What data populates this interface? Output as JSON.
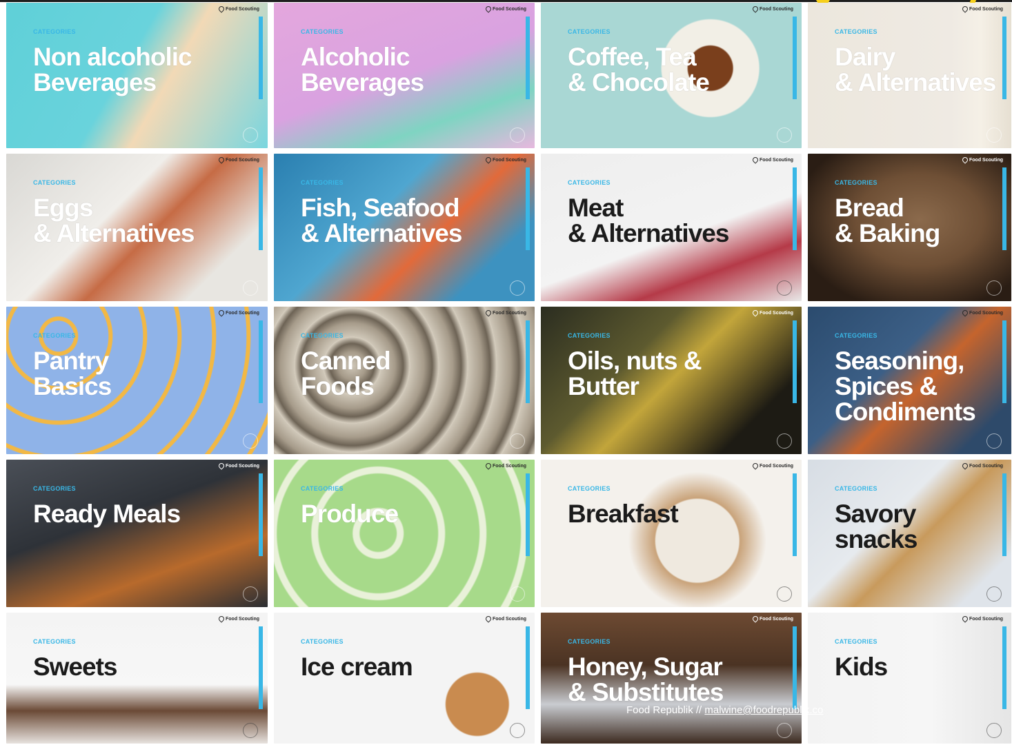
{
  "brand": "Food Scouting",
  "badge_text": "Food Republik",
  "tiles": [
    {
      "category": "CATEGORIES",
      "title": "Non alcoholic\nBeverages",
      "theme": "light",
      "bg": "linear-gradient(120deg,#5fd0d8 0%,#69d3dc 45%,#f2d9b6 60%,#79d6df 100%)"
    },
    {
      "category": "CATEGORIES",
      "title": "Alcoholic\nBeverages",
      "theme": "light",
      "bg": "linear-gradient(160deg,#e4a7dd 0%,#d9a2e0 50%,#7fd4c2 75%,#e7b8de 100%)"
    },
    {
      "category": "CATEGORIES",
      "title": "Coffee, Tea\n& Chocolate",
      "theme": "light",
      "bg": "radial-gradient(circle at 65% 45%,#7a3f1c 0,#7a3f1c 32px,#f2efe6 34px,#f2efe6 70px,#a9d7d4 72px)"
    },
    {
      "category": "CATEGORIES",
      "title": "Dairy\n& Alternatives",
      "theme": "light",
      "bg": "linear-gradient(90deg,#ece7dd 0%,#efeae3 70%,#f5f0e6 85%,#e6dfd2 100%)"
    },
    {
      "category": "CATEGORIES",
      "title": "Eggs\n& Alternatives",
      "theme": "light",
      "bg": "linear-gradient(135deg,#d9d8d4 0%,#f0eeea 40%,#c66b45 55%,#e8e6e1 80%)"
    },
    {
      "category": "CATEGORIES",
      "title": "Fish, Seafood\n& Alternatives",
      "theme": "light",
      "bg": "linear-gradient(135deg,#2a7fb0 0%,#4fa6d0 40%,#e26a3a 60%,#3d92c0 80%)"
    },
    {
      "category": "CATEGORIES",
      "title": "Meat\n& Alternatives",
      "theme": "dark",
      "bg": "linear-gradient(160deg,#eeeeee 0%,#f3f3f3 55%,#b53a48 75%,#e8e8e8 100%)"
    },
    {
      "category": "CATEGORIES",
      "title": "Bread\n& Baking",
      "theme": "light",
      "bg": "radial-gradient(ellipse at 55% 45%,#8b6a4c 0,#6e4f35 40%,#2a1d14 80%)"
    },
    {
      "category": "CATEGORIES",
      "title": "Pantry\nBasics",
      "theme": "light",
      "bg": "repeating-radial-gradient(circle at 20% 20%,#8fb3e8 0,#8fb3e8 22px,#f2b845 23px,#f2b845 28px,#8fb3e8 29px,#8fb3e8 50px)"
    },
    {
      "category": "CATEGORIES",
      "title": "Canned\nFoods",
      "theme": "light",
      "bg": "repeating-radial-gradient(circle at 30% 40%,#cfc7b8 0,#a69b8a 20px,#6d6355 32px,#d9d1c2 42px)"
    },
    {
      "category": "CATEGORIES",
      "title": "Oils, nuts &\nButter",
      "theme": "light",
      "bg": "linear-gradient(135deg,#2b2d20 0%,#5d5a2f 35%,#c2a53b 50%,#1d1b14 80%)"
    },
    {
      "category": "CATEGORIES",
      "title": "Seasoning,\nSpices &\nCondiments",
      "theme": "light",
      "bg": "linear-gradient(135deg,#2b4b6e 0%,#3c5f86 40%,#c5642d 55%,#2e4a6a 85%)"
    },
    {
      "category": "CATEGORIES",
      "title": "Ready Meals",
      "theme": "light",
      "bg": "linear-gradient(160deg,#4a4f57 0%,#2e3238 40%,#b86a2c 70%,#2b2e33 100%)"
    },
    {
      "category": "CATEGORIES",
      "title": "Produce",
      "theme": "light",
      "bg": "repeating-radial-gradient(circle at 40% 50%,#a7da8a 0,#a7da8a 26px,#e9f1d9 28px,#e9f1d9 36px,#a7da8a 38px,#a7da8a 60px)"
    },
    {
      "category": "CATEGORIES",
      "title": "Breakfast",
      "theme": "dark",
      "bg": "radial-gradient(circle at 60% 55%,#efe9df 0,#efe9df 60px,#c9a37a 62px,#f4f1ec 100px)"
    },
    {
      "category": "CATEGORIES",
      "title": "Savory\nsnacks",
      "theme": "dark",
      "bg": "linear-gradient(135deg,#d7dde4 0%,#e6eaee 40%,#c89a5c 55%,#dfe4ea 85%)"
    },
    {
      "category": "CATEGORIES",
      "title": "Sweets",
      "theme": "dark",
      "bg": "linear-gradient(180deg,#f4f4f4 0%,#f7f7f7 55%,#6b4a36 75%,#e7e2de 100%)"
    },
    {
      "category": "CATEGORIES",
      "title": "Ice cream",
      "theme": "dark",
      "bg": "radial-gradient(circle at 78% 70%,#c98b4f 0,#c98b4f 45px,#f4f4f4 47px)"
    },
    {
      "category": "CATEGORIES",
      "title": "Honey, Sugar\n& Substitutes",
      "theme": "light",
      "bg": "linear-gradient(180deg,#6d4a32 0%,#4b3323 40%,#c9ccd1 70%,#3c2a1f 100%)"
    },
    {
      "category": "CATEGORIES",
      "title": "Kids",
      "theme": "dark",
      "bg": "linear-gradient(90deg,#f3f3f3 0%,#f6f6f6 60%,#e5e5e5 100%)"
    }
  ],
  "footer": {
    "company": "Food Republik // ",
    "email": "malwine@foodrepublik.co"
  }
}
